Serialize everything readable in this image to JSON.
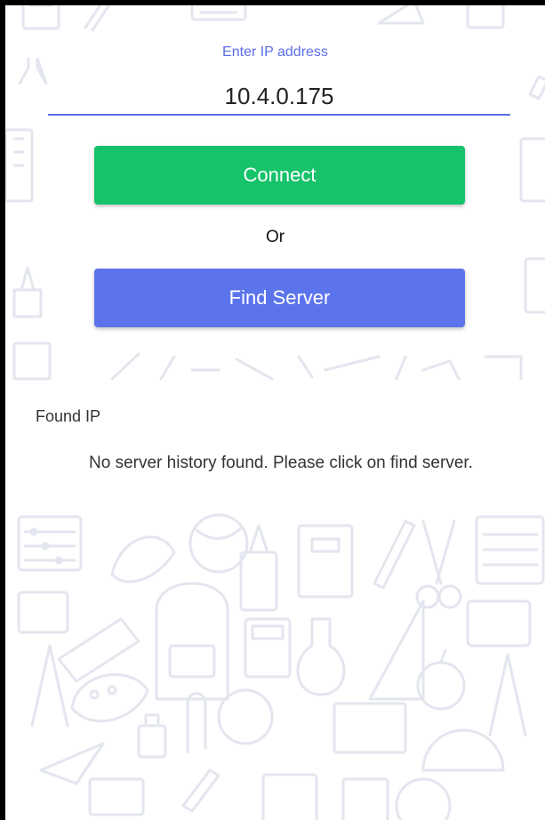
{
  "ip_section": {
    "label": "Enter IP address",
    "value": "10.4.0.175"
  },
  "buttons": {
    "connect_label": "Connect",
    "or_text": "Or",
    "find_server_label": "Find Server"
  },
  "found": {
    "heading": "Found IP",
    "message": "No server history found. Please click on find server."
  },
  "colors": {
    "accent": "#5b6ee8",
    "connect": "#16c26a",
    "find_server": "#5b74ec",
    "doodle": "#e6e8ef"
  },
  "background": {
    "pattern_icons": [
      "abacus-icon",
      "globe-icon",
      "backpack-icon",
      "glue-icon",
      "ruler-icon",
      "pencil-icon",
      "scissors-icon",
      "flask-icon",
      "apple-icon",
      "book-icon",
      "compass-icon",
      "triangle-ruler-icon",
      "protractor-icon",
      "calculator-icon",
      "paint-palette-icon",
      "sharpener-icon",
      "eraser-icon",
      "paper-plane-icon",
      "ink-bottle-icon",
      "paperclip-icon",
      "notebook-icon"
    ]
  }
}
